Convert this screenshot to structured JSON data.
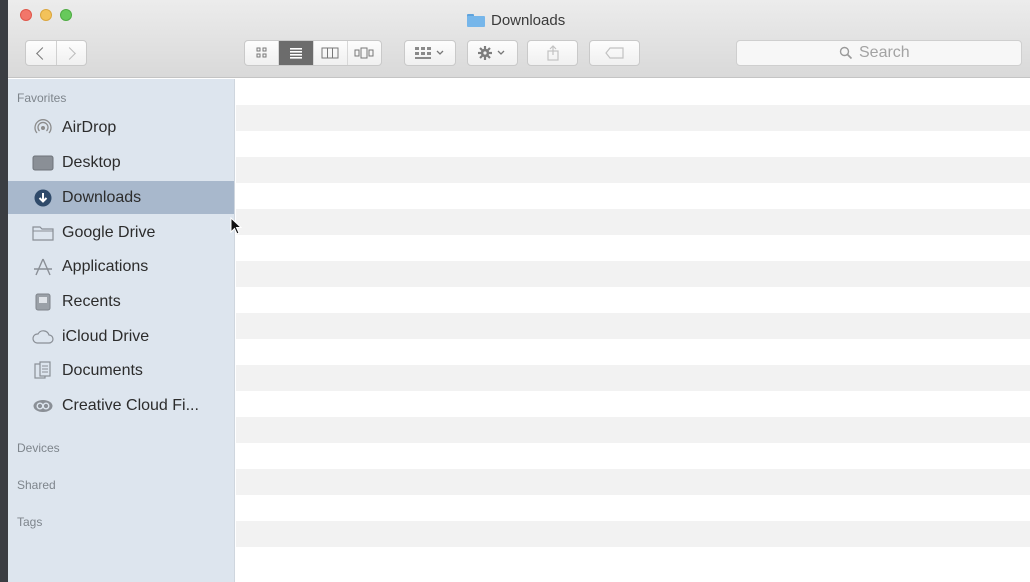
{
  "window": {
    "title": "Downloads",
    "accent": "#a8b8cc"
  },
  "toolbar": {
    "back_icon": "chevron-left-icon",
    "forward_icon": "chevron-right-icon",
    "view_modes": [
      "icon-view",
      "list-view",
      "column-view",
      "cover-flow-view"
    ],
    "active_view": "list-view",
    "arrange_icon": "arrange-grid-icon",
    "action_icon": "gear-icon",
    "share_icon": "share-icon",
    "tag_icon": "tag-icon"
  },
  "search": {
    "placeholder": "Search"
  },
  "sidebar": {
    "favorites_label": "Favorites",
    "devices_label": "Devices",
    "shared_label": "Shared",
    "tags_label": "Tags",
    "items": [
      {
        "label": "AirDrop",
        "icon": "airdrop-icon"
      },
      {
        "label": "Desktop",
        "icon": "desktop-icon"
      },
      {
        "label": "Downloads",
        "icon": "downloads-icon",
        "selected": true
      },
      {
        "label": "Google Drive",
        "icon": "folder-icon"
      },
      {
        "label": "Applications",
        "icon": "applications-icon"
      },
      {
        "label": "Recents",
        "icon": "recents-icon"
      },
      {
        "label": "iCloud Drive",
        "icon": "cloud-icon"
      },
      {
        "label": "Documents",
        "icon": "documents-icon"
      },
      {
        "label": "Creative Cloud Fi...",
        "icon": "creative-cloud-icon"
      }
    ]
  }
}
